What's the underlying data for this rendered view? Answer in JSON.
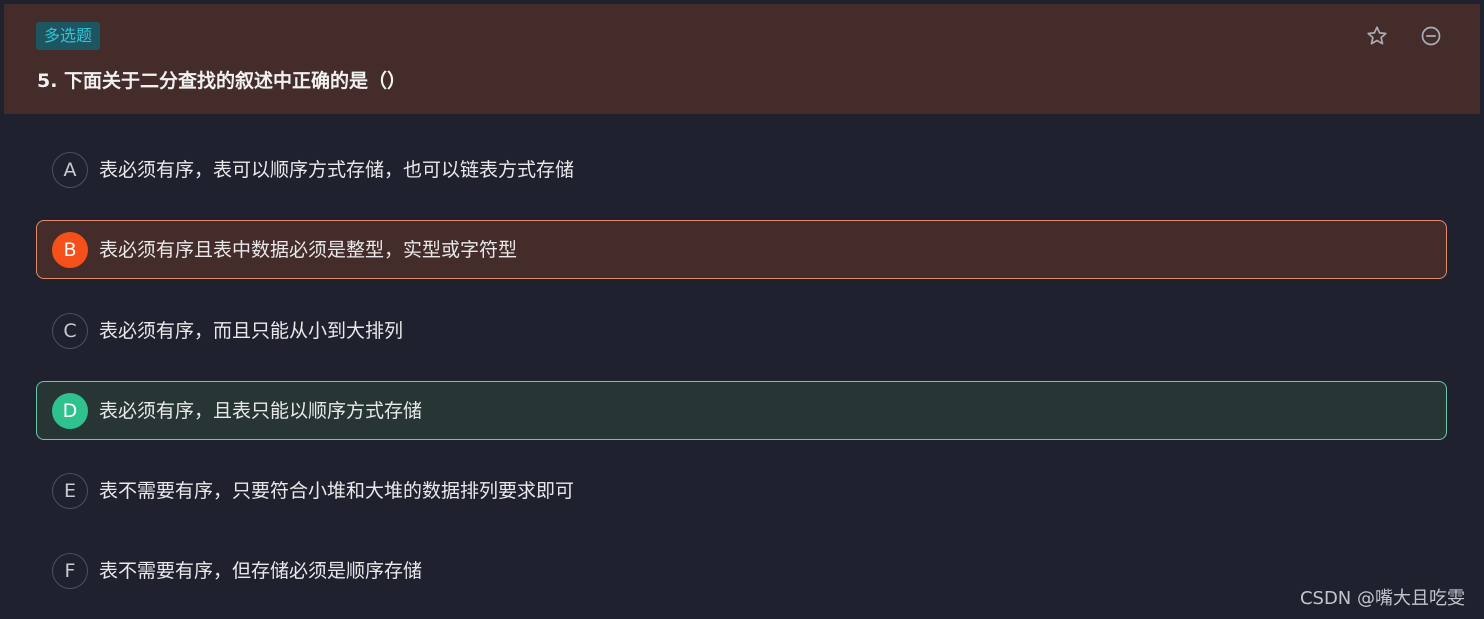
{
  "question": {
    "type_badge": "多选题",
    "title": "5. 下面关于二分查找的叙述中正确的是（）"
  },
  "header_icons": {
    "favorite": "star-outline-icon",
    "collapse": "minus-circle-icon"
  },
  "options": [
    {
      "letter": "A",
      "text": "表必须有序，表可以顺序方式存储，也可以链表方式存储",
      "state": "none"
    },
    {
      "letter": "B",
      "text": "表必须有序且表中数据必须是整型，实型或字符型",
      "state": "wrong"
    },
    {
      "letter": "C",
      "text": "表必须有序，而且只能从小到大排列",
      "state": "none"
    },
    {
      "letter": "D",
      "text": "表必须有序，且表只能以顺序方式存储",
      "state": "correct"
    },
    {
      "letter": "E",
      "text": "表不需要有序，只要符合小堆和大堆的数据排列要求即可",
      "state": "none"
    },
    {
      "letter": "F",
      "text": "表不需要有序，但存储必须是顺序存储",
      "state": "none"
    }
  ],
  "watermark": "CSDN @嘴大且吃雯",
  "colors": {
    "background": "#1f222e",
    "header_bg": "#432c29",
    "badge_bg": "#1d5560",
    "badge_text": "#36c0d6",
    "wrong_accent": "#f5501b",
    "wrong_border": "#e18b6a",
    "correct_accent": "#2fc28f",
    "correct_border": "#6cc7a8"
  }
}
